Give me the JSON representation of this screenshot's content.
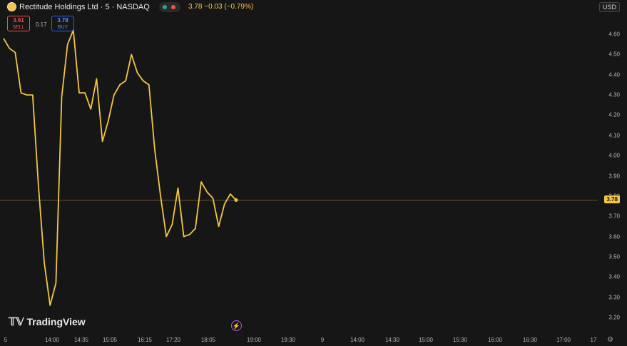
{
  "header": {
    "title": "Rectitude Holdings Ltd · 5 · NASDAQ",
    "quote": "3.78 −0.03 (−0.79%)",
    "currency": "USD"
  },
  "trade": {
    "sell_price": "3.61",
    "sell_label": "SELL",
    "spread": "0.17",
    "buy_price": "3.78",
    "buy_label": "BUY"
  },
  "brand": {
    "mark": "𝕋𝕍",
    "name": "TradingView"
  },
  "colors": {
    "line": "#f5c542",
    "background": "#161616",
    "sell": "#ef5350",
    "buy": "#2962ff"
  },
  "chart_data": {
    "type": "line",
    "title": "Rectitude Holdings Ltd · 5 · NASDAQ",
    "y_ticks": [
      "4.60",
      "4.50",
      "4.40",
      "4.30",
      "4.20",
      "4.10",
      "4.00",
      "3.90",
      "3.80",
      "3.70",
      "3.60",
      "3.50",
      "3.40",
      "3.30",
      "3.20"
    ],
    "x_ticks": [
      "5",
      "14:00",
      "14:35",
      "15:05",
      "16:15",
      "17:20",
      "18:05",
      "19:00",
      "19:30",
      "9",
      "14:00",
      "14:30",
      "15:00",
      "15:30",
      "16:00",
      "16:30",
      "17:00",
      "17"
    ],
    "current_value": "3.78",
    "ylim": [
      3.17,
      4.65
    ],
    "series": [
      {
        "values": [
          4.58,
          4.53,
          4.51,
          4.31,
          4.3,
          4.3,
          3.85,
          3.47,
          3.26,
          3.37,
          4.29,
          4.55,
          4.62,
          4.31,
          4.31,
          4.23,
          4.38,
          4.07,
          4.17,
          4.3,
          4.35,
          4.37,
          4.5,
          4.41,
          4.37,
          4.35,
          4.03,
          3.8,
          3.6,
          3.66,
          3.84,
          3.6,
          3.61,
          3.64,
          3.87,
          3.82,
          3.79,
          3.65,
          3.76,
          3.81,
          3.78
        ]
      }
    ]
  }
}
